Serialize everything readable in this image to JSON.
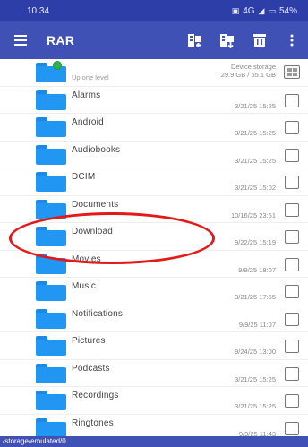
{
  "status": {
    "time": "10:34",
    "indicators": "4G",
    "battery": "54%"
  },
  "app_bar": {
    "title": "RAR",
    "actions": [
      "archive-add-icon",
      "archive-extract-icon",
      "delete-icon",
      "more-vert-icon"
    ]
  },
  "up_row": {
    "name": "Up one level",
    "info_line1": "Device storage",
    "info_line2": "29.9 GB / 55.1 GB"
  },
  "files": [
    {
      "name": "Alarms",
      "date": "3/21/25 15:25"
    },
    {
      "name": "Android",
      "date": "3/21/25 15:25"
    },
    {
      "name": "Audiobooks",
      "date": "3/21/25 15:25"
    },
    {
      "name": "DCIM",
      "date": "3/21/25 15:02"
    },
    {
      "name": "Documents",
      "date": "10/16/25 23:51"
    },
    {
      "name": "Download",
      "date": "9/22/25 15:19"
    },
    {
      "name": "Movies",
      "date": "9/9/25 18:07"
    },
    {
      "name": "Music",
      "date": "3/21/25 17:55"
    },
    {
      "name": "Notifications",
      "date": "9/9/25 11:07"
    },
    {
      "name": "Pictures",
      "date": "9/24/25 13:00"
    },
    {
      "name": "Podcasts",
      "date": "3/21/25 15:25"
    },
    {
      "name": "Recordings",
      "date": "3/21/25 15:25"
    },
    {
      "name": "Ringtones",
      "date": "9/9/25 11:43"
    }
  ],
  "path": "/storage/emulated/0",
  "colors": {
    "primary": "#3f51b5",
    "status_bar": "#2e3ea8",
    "folder": "#2196f3",
    "annotation": "#e21a1a"
  }
}
